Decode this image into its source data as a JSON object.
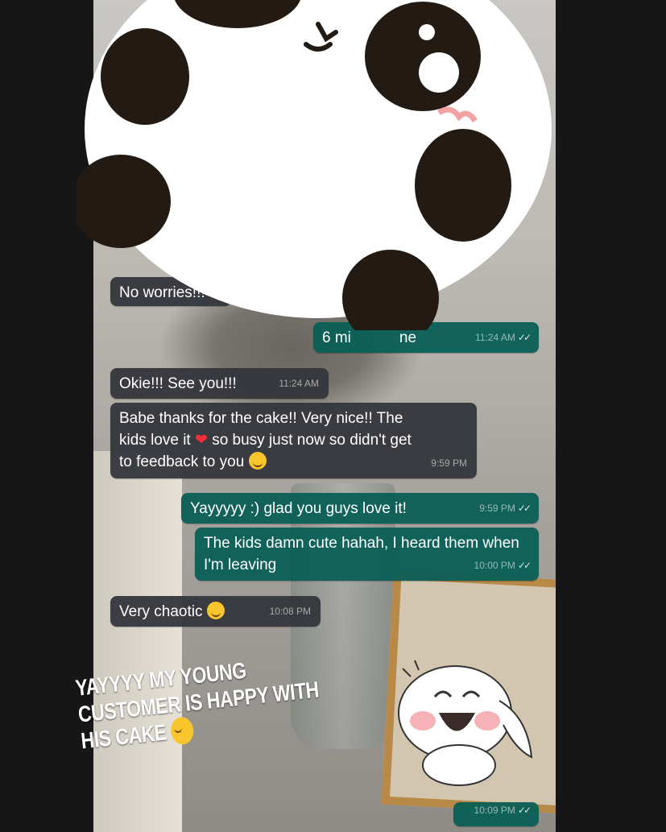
{
  "messages": [
    {
      "dir": "in",
      "text": "No worries!!!",
      "time": ""
    },
    {
      "dir": "out",
      "text": "6 mi",
      "text_tail": "ne",
      "time": "11:24 AM"
    },
    {
      "dir": "in",
      "text": "Okie!!! See you!!!",
      "time": "11:24 AM"
    },
    {
      "dir": "in",
      "text_a": "Babe thanks for the cake!! Very nice!! The kids love it",
      "text_b": "so busy just now so didn't get to feedback to you",
      "time": "9:59 PM"
    },
    {
      "dir": "out",
      "text": "Yayyyyy :) glad you guys love it!",
      "time": "9:59 PM"
    },
    {
      "dir": "out",
      "text": "The kids damn cute hahah, I heard them when I'm leaving",
      "time": "10:00 PM"
    },
    {
      "dir": "in",
      "text": "Very chaotic",
      "time": "10:08 PM"
    },
    {
      "dir": "out",
      "text": "",
      "time": "10:09 PM"
    }
  ],
  "caption": "YAYYYY MY YOUNG CUSTOMER IS HAPPY WITH HIS CAKE",
  "icons": {
    "ticks": "double-check-icon",
    "heart": "red-heart-emoji",
    "sweat": "sweat-smile-emoji",
    "laugh": "tears-of-joy-emoji",
    "relieved": "relieved-face-emoji"
  },
  "colors": {
    "incoming": "#34363c",
    "outgoing": "#0a5f56",
    "background": "#161616",
    "heart": "#ff2d3a"
  }
}
